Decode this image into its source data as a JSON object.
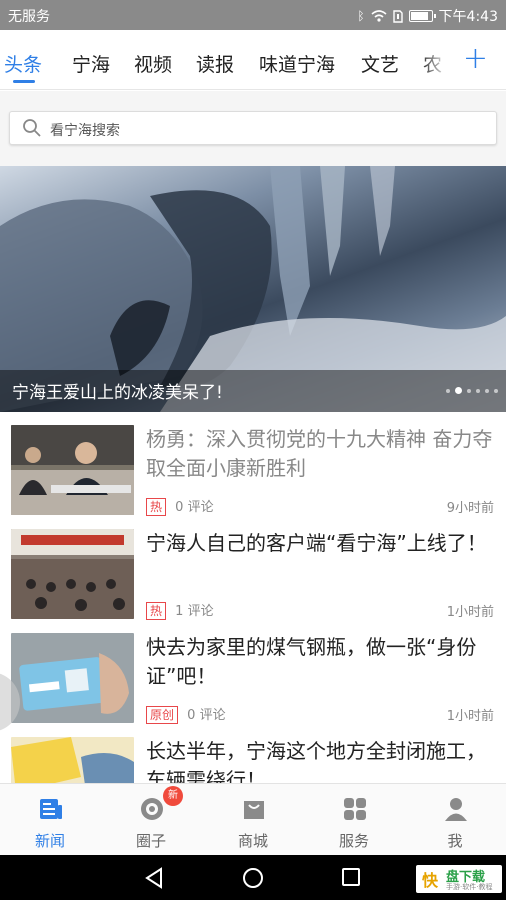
{
  "status_bar": {
    "carrier": "无服务",
    "time": "下午4:43",
    "battery_level": 0.9
  },
  "tabs": {
    "items": [
      {
        "label": "头条",
        "active": true
      },
      {
        "label": "宁海"
      },
      {
        "label": "视频"
      },
      {
        "label": "读报"
      },
      {
        "label": "味道宁海"
      },
      {
        "label": "文艺"
      },
      {
        "label": "农"
      }
    ],
    "add_icon": "plus-icon"
  },
  "search": {
    "placeholder": "看宁海搜索",
    "icon": "search-icon"
  },
  "banner": {
    "caption": "宁海王爱山上的冰凌美呆了!",
    "dot_count": 6,
    "active_dot": 1
  },
  "news": [
    {
      "title": "杨勇：深入贯彻党的十九大精神 奋力夺取全面小康新胜利",
      "tag": "热",
      "comments": "0",
      "comment_label": "评论",
      "time": "9小时前",
      "read": true
    },
    {
      "title": "宁海人自己的客户端“看宁海”上线了！",
      "tag": "热",
      "comments": "1",
      "comment_label": "评论",
      "time": "1小时前",
      "read": false
    },
    {
      "title": "快去为家里的煤气钢瓶，做一张“身份证”吧！",
      "tag": "原创",
      "comments": "0",
      "comment_label": "评论",
      "time": "1小时前",
      "read": false
    },
    {
      "title": "长达半年，宁海这个地方全封闭施工，车辆需绕行！",
      "read": false
    }
  ],
  "bottom_nav": {
    "items": [
      {
        "label": "新闻",
        "icon": "news-icon",
        "active": true
      },
      {
        "label": "圈子",
        "icon": "circle-icon",
        "badge": "新"
      },
      {
        "label": "商城",
        "icon": "shopping-bag-icon"
      },
      {
        "label": "服务",
        "icon": "grid-icon"
      },
      {
        "label": "我",
        "icon": "user-icon"
      }
    ]
  },
  "system_nav": {
    "watermark_a": "快",
    "watermark_b": "盘下载",
    "watermark_c": "手游·软件·教程"
  },
  "colors": {
    "accent": "#2f7fe6",
    "tag_red": "#e8474a",
    "badge_red": "#f04a3c"
  }
}
